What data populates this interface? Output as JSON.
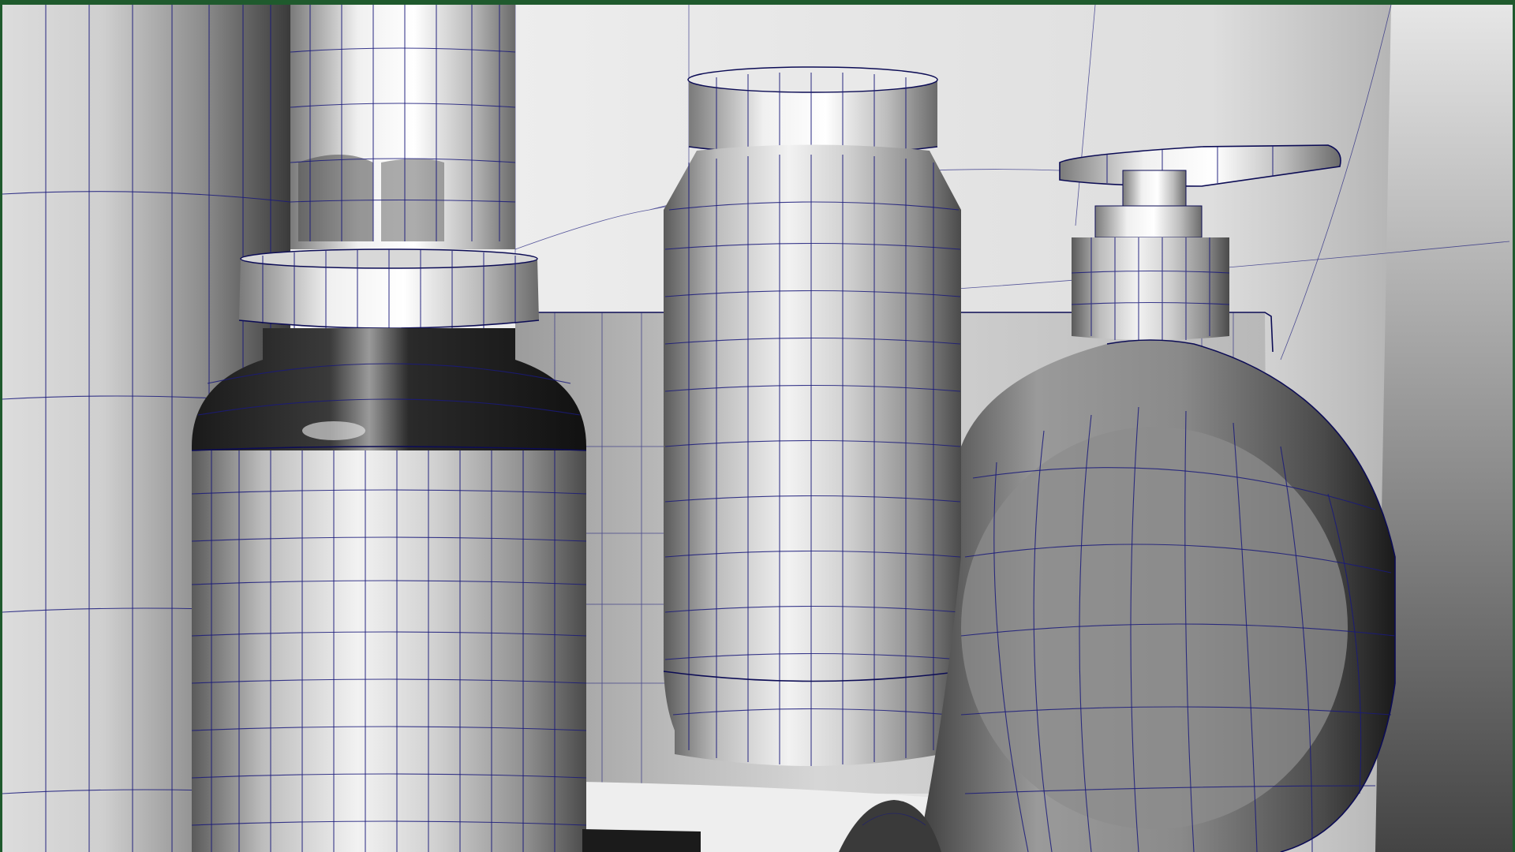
{
  "app": {
    "view": "perspective-viewport",
    "shading": "smooth-shaded-wireframe-on-shaded",
    "colors": {
      "border": "#1f5a2d",
      "wire": "#1a1a7a",
      "backdrop": "#f4f4f4"
    }
  },
  "scene": {
    "objects": [
      {
        "name": "left-tall-cylinder"
      },
      {
        "name": "pump-bottle-top-left"
      },
      {
        "name": "dark-shoulder-jar"
      },
      {
        "name": "center-capped-jar"
      },
      {
        "name": "soap-pump-bottle"
      },
      {
        "name": "shelf-panel"
      },
      {
        "name": "floor-block"
      }
    ]
  }
}
